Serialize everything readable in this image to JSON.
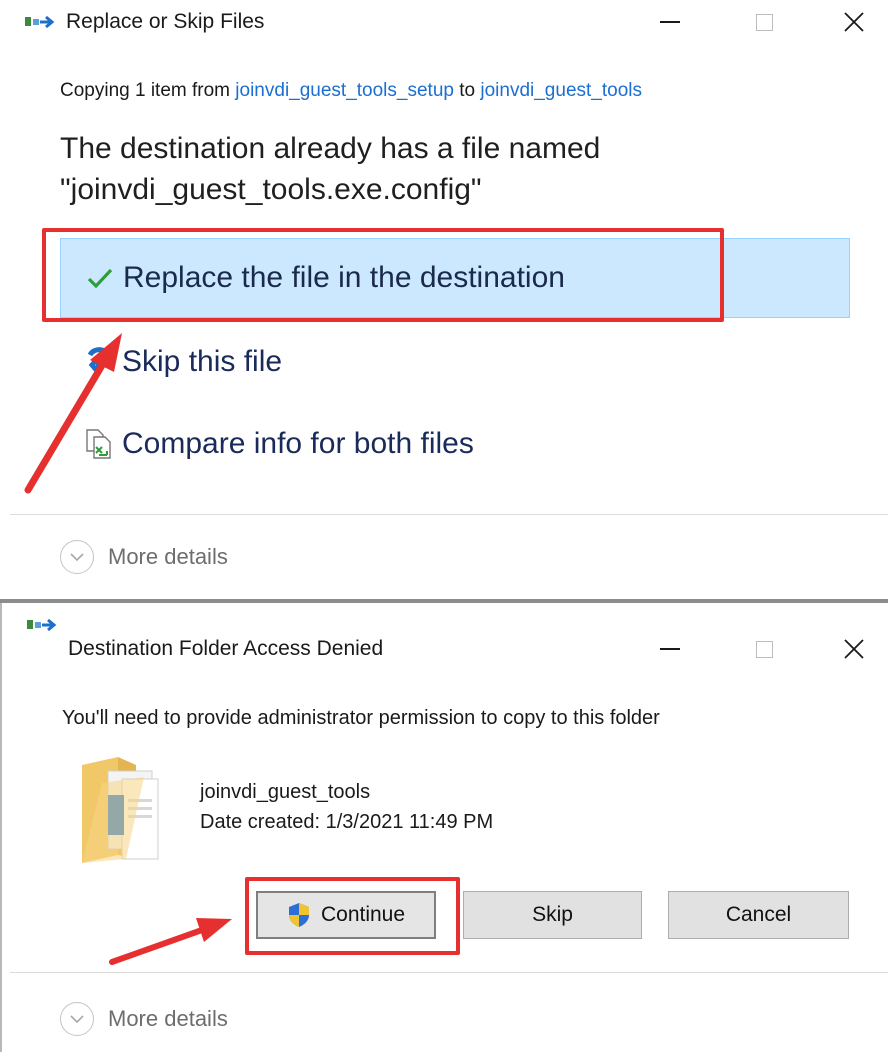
{
  "dialog1": {
    "title": "Replace or Skip Files",
    "copy_prefix": "Copying 1 item from ",
    "source_link": "joinvdi_guest_tools_setup",
    "copy_middle": " to ",
    "dest_link": "joinvdi_guest_tools",
    "message_line1": "The destination already has a file named",
    "message_line2": "\"joinvdi_guest_tools.exe.config\"",
    "options": [
      {
        "label": "Replace the file in the destination",
        "icon": "checkmark-icon"
      },
      {
        "label": "Skip this file",
        "icon": "skip-icon"
      },
      {
        "label": "Compare info for both files",
        "icon": "compare-icon"
      }
    ],
    "more_details": "More details"
  },
  "dialog2": {
    "title": "Destination Folder Access Denied",
    "message": "You'll need to provide administrator permission to copy to this folder",
    "folder_name": "joinvdi_guest_tools",
    "date_created": "Date created: 1/3/2021 11:49 PM",
    "buttons": {
      "continue": "Continue",
      "skip": "Skip",
      "cancel": "Cancel"
    },
    "more_details": "More details"
  },
  "colors": {
    "link": "#1a6fd1",
    "selected_bg": "#cce8ff",
    "annotation_red": "#e63030",
    "checkmark_green": "#2e9e3a"
  }
}
